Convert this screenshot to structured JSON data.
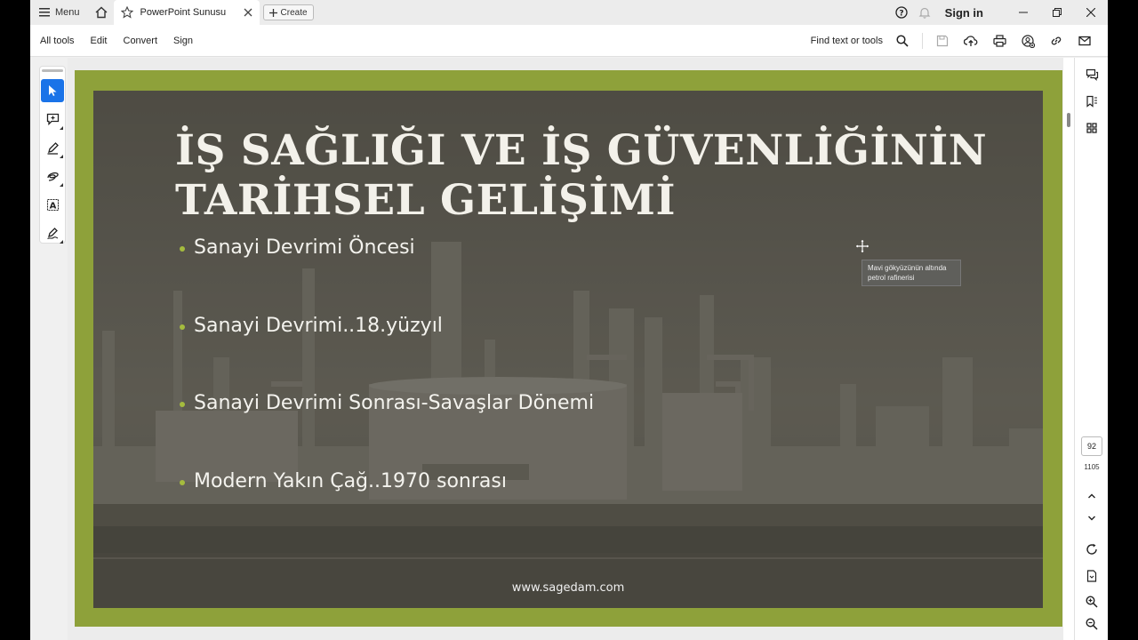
{
  "titlebar": {
    "menu_label": "Menu",
    "tab_title": "PowerPoint Sunusu",
    "create_label": "Create",
    "sign_in": "Sign in"
  },
  "toolbar": {
    "items": [
      "All tools",
      "Edit",
      "Convert",
      "Sign"
    ],
    "find_label": "Find text or tools"
  },
  "slide": {
    "title_line1": "İŞ SAĞLIĞI VE İŞ GÜVENLİĞİNİN",
    "title_line2": "TARİHSEL GELİŞİMİ",
    "bullets": [
      "Sanayi Devrimi Öncesi",
      "Sanayi Devrimi..18.yüzyıl",
      "Sanayi Devrimi Sonrası-Savaşlar Dönemi",
      "Modern Yakın Çağ..1970 sonrası"
    ],
    "footer": "www.sagedam.com",
    "tooltip_line1": "Mavi gökyüzünün altında",
    "tooltip_line2": "petrol rafinerisi"
  },
  "pagination": {
    "current": "92",
    "total": "1105"
  },
  "colors": {
    "accent": "#1a73e8",
    "slide_border": "#8ea13a",
    "bullet_dot": "#a5bc3e"
  }
}
